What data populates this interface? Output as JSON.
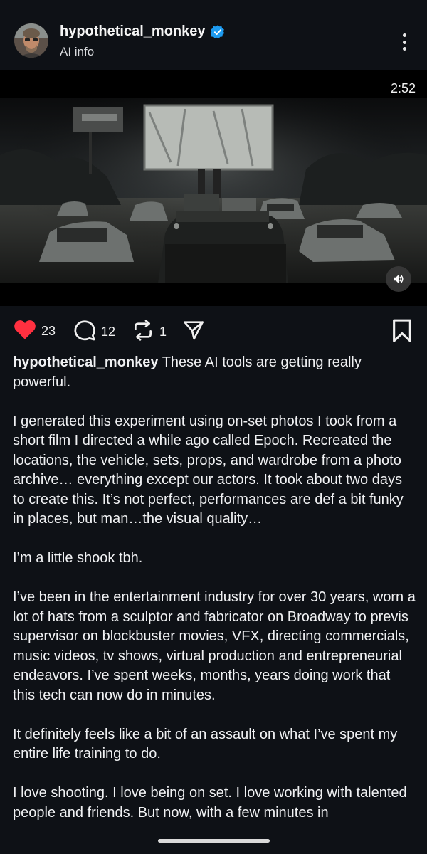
{
  "post": {
    "author": "hypothetical_monkey",
    "subtitle": "AI info",
    "verified_icon": "verified-badge-icon",
    "accent_color": "#1d9bf0"
  },
  "video": {
    "duration": "2:52",
    "sound_icon": "speaker-icon"
  },
  "actions": {
    "like_count": "23",
    "comment_count": "12",
    "repost_count": "1",
    "like_color": "#ff3040",
    "icons": [
      "heart-icon",
      "comment-icon",
      "repost-icon",
      "share-icon",
      "bookmark-icon"
    ]
  },
  "caption": {
    "author": "hypothetical_monkey",
    "first_line": " These AI tools are getting really powerful.",
    "paragraphs": [
      "I generated this experiment using on-set photos I took from a short film I directed a while ago called Epoch. Recreated the locations, the vehicle, sets, props, and wardrobe from a photo archive… everything except our actors. It took about two days to create this. It’s not perfect, performances are def a bit funky in places, but man…the visual quality…",
      "I’m a little shook tbh.",
      "I’ve been in the entertainment industry for over 30 years, worn a lot of hats from a sculptor and fabricator on Broadway to previs supervisor on blockbuster movies, VFX, directing commercials, music videos, tv shows, virtual production and entrepreneurial endeavors. I’ve spent weeks, months, years doing work that this tech can now do in minutes.",
      "It definitely feels like a bit of an assault on what I’ve spent my entire life training to do.",
      "I love shooting. I love being on set. I love working with talented people and friends. But now, with a few minutes in"
    ]
  }
}
